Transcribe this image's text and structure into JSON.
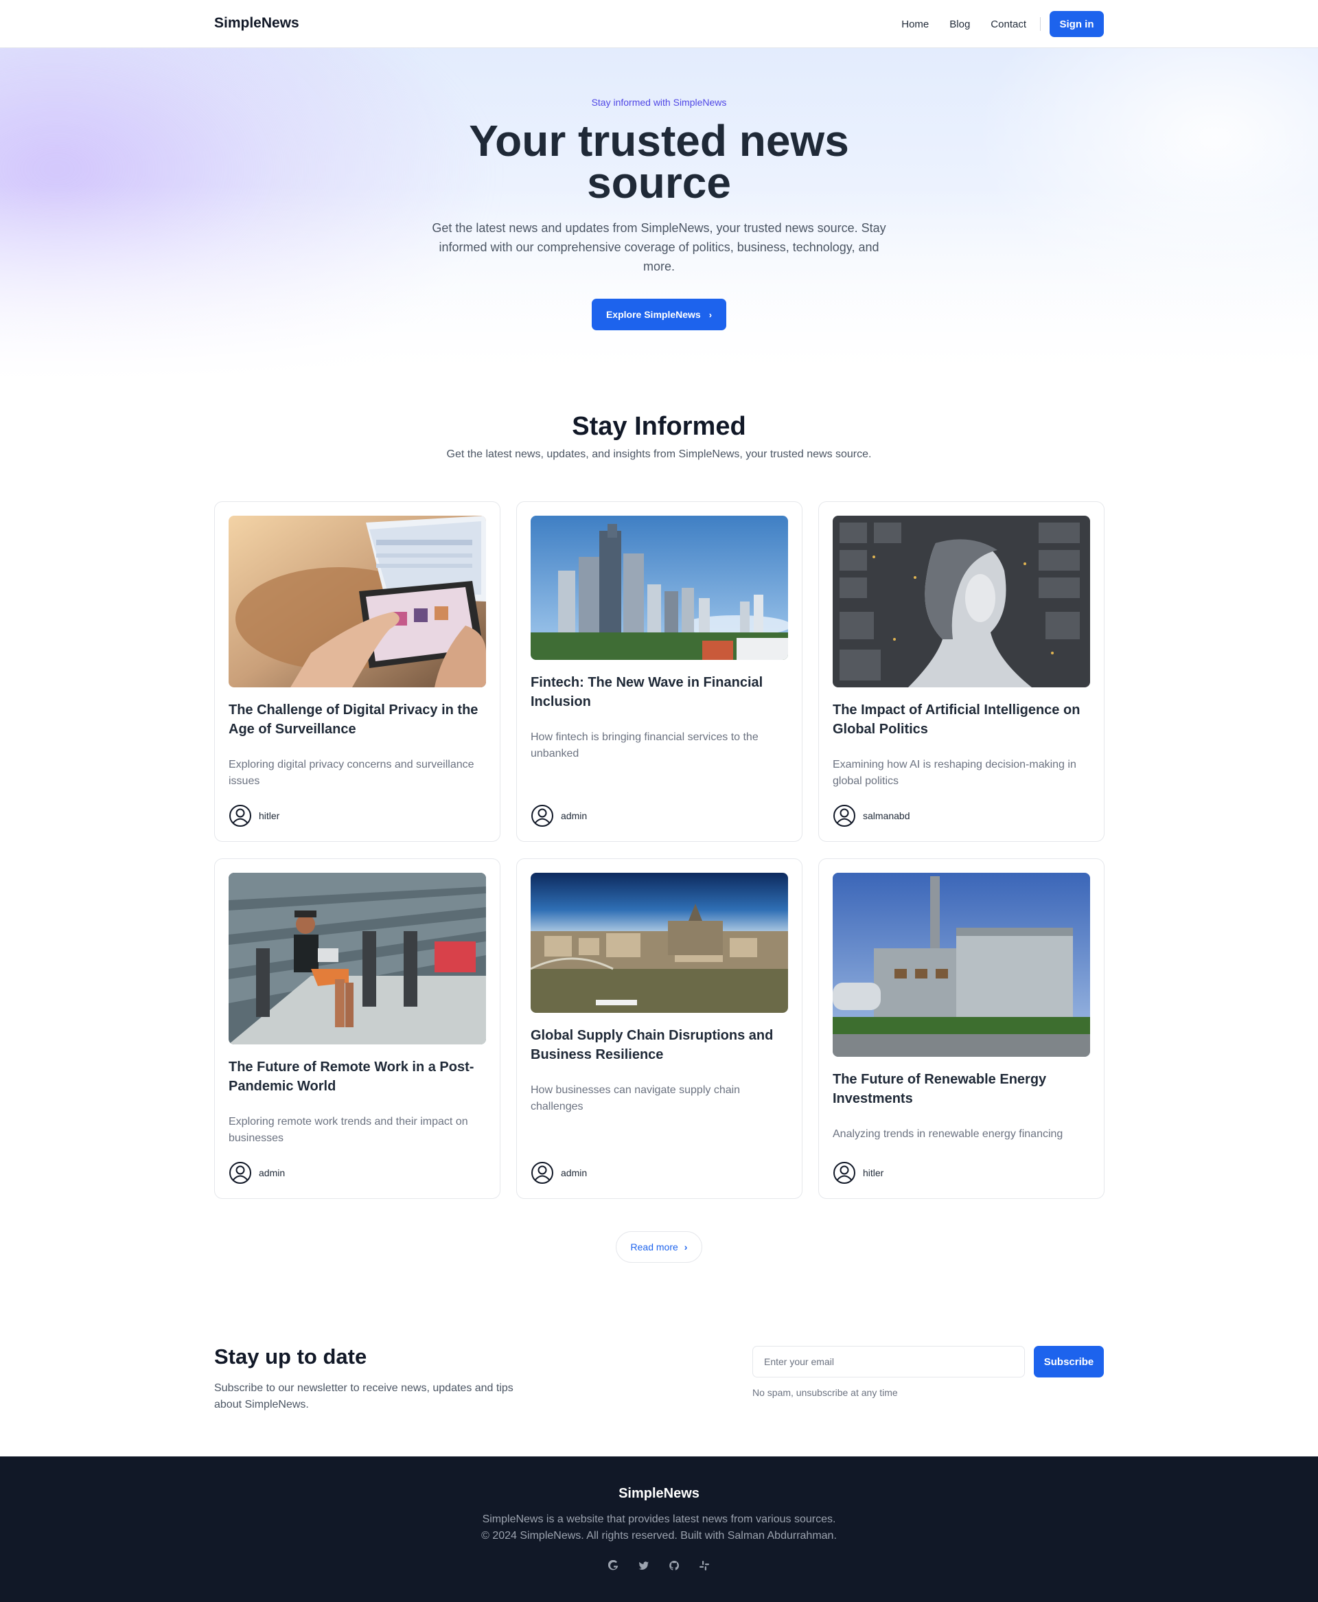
{
  "header": {
    "brand": "SimpleNews",
    "nav": [
      "Home",
      "Blog",
      "Contact"
    ],
    "signin_label": "Sign in"
  },
  "hero": {
    "eyebrow": "Stay informed with SimpleNews",
    "title": "Your trusted news source",
    "description": "Get the latest news and updates from SimpleNews, your trusted news source. Stay informed with our comprehensive coverage of politics, business, technology, and more.",
    "cta_label": "Explore SimpleNews"
  },
  "section": {
    "title": "Stay Informed",
    "subtitle": "Get the latest news, updates, and insights from SimpleNews, your trusted news source."
  },
  "articles": [
    {
      "title": "The Challenge of Digital Privacy in the Age of Surveillance",
      "description": "Exploring digital privacy concerns and surveillance issues",
      "author": "hitler",
      "image": "laptop-tablet-photo"
    },
    {
      "title": "Fintech: The New Wave in Financial Inclusion",
      "description": "How fintech is bringing financial services to the unbanked",
      "author": "admin",
      "image": "city-skyline-photo"
    },
    {
      "title": "The Impact of Artificial Intelligence on Global Politics",
      "description": "Examining how AI is reshaping decision-making in global politics",
      "author": "salmanabd",
      "image": "ai-robot-head-photo"
    },
    {
      "title": "The Future of Remote Work in a Post-Pandemic World",
      "description": "Exploring remote work trends and their impact on businesses",
      "author": "admin",
      "image": "remote-worker-photo"
    },
    {
      "title": "Global Supply Chain Disruptions and Business Resilience",
      "description": "How businesses can navigate supply chain challenges",
      "author": "admin",
      "image": "river-city-photo"
    },
    {
      "title": "The Future of Renewable Energy Investments",
      "description": "Analyzing trends in renewable energy financing",
      "author": "hitler",
      "image": "power-plant-photo"
    }
  ],
  "read_more_label": "Read more",
  "newsletter": {
    "title": "Stay up to date",
    "description": "Subscribe to our newsletter to receive news, updates and tips about SimpleNews.",
    "email_placeholder": "Enter your email",
    "subscribe_label": "Subscribe",
    "note": "No spam, unsubscribe at any time"
  },
  "footer": {
    "brand": "SimpleNews",
    "line1": "SimpleNews is a website that provides latest news from various sources.",
    "line2": "© 2024 SimpleNews. All rights reserved. Built with Salman Abdurrahman.",
    "socials": [
      "google-icon",
      "twitter-icon",
      "github-icon",
      "slack-icon"
    ]
  },
  "colors": {
    "accent": "#1d63ed",
    "eyebrow": "#4f46e5",
    "footer_bg": "#111827"
  }
}
